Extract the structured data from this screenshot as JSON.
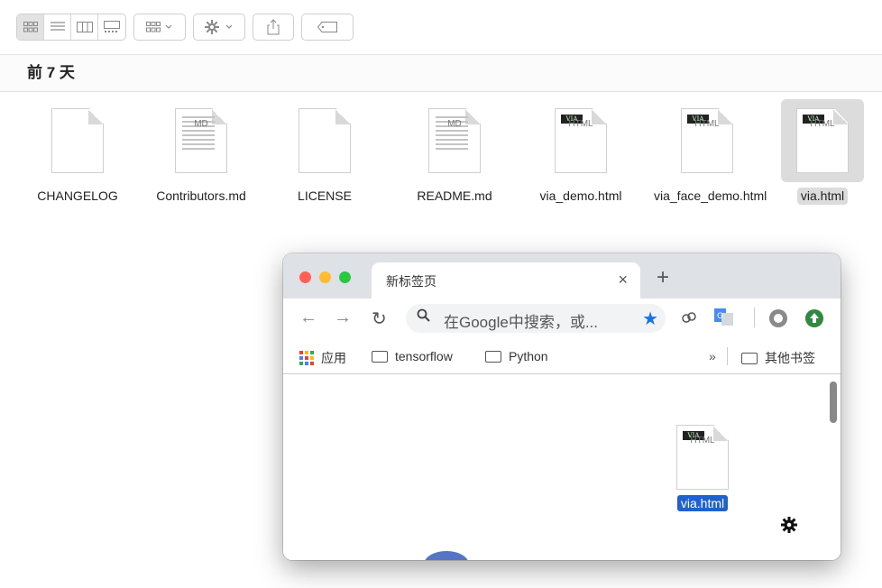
{
  "finder": {
    "section_title": "前 7 天",
    "toolbar": {
      "view_icons": [
        "icon-view-icon",
        "list-view-icon",
        "column-view-icon",
        "gallery-view-icon"
      ],
      "group_icon": "group-by-icon",
      "action_icon": "gear-icon",
      "share_icon": "share-icon",
      "tag_icon": "tag-icon"
    },
    "files": [
      {
        "name": "CHANGELOG",
        "ext": "",
        "kind": "plain"
      },
      {
        "name": "Contributors.md",
        "ext": "MD",
        "kind": "text"
      },
      {
        "name": "LICENSE",
        "ext": "",
        "kind": "plain"
      },
      {
        "name": "README.md",
        "ext": "MD",
        "kind": "text"
      },
      {
        "name": "via_demo.html",
        "ext": "HTML",
        "kind": "via"
      },
      {
        "name": "via_face_demo.html",
        "ext": "HTML",
        "kind": "via"
      },
      {
        "name": "via.html",
        "ext": "HTML",
        "kind": "via",
        "selected": true
      }
    ]
  },
  "chrome": {
    "tab_title": "新标签页",
    "tab_close": "×",
    "new_tab": "+",
    "omnibox_placeholder": "在Google中搜索，或...",
    "bookmarks": {
      "apps_label": "应用",
      "items": [
        "tensorflow",
        "Python"
      ],
      "overflow": "»",
      "other": "其他书签"
    },
    "drag_file": {
      "name": "via.html",
      "ext": "HTML",
      "badge": "VIA"
    }
  },
  "colors": {
    "accent": "#1a73e8",
    "selection": "#1e62d0",
    "traffic_red": "#fe5f57",
    "traffic_yellow": "#febc2e",
    "traffic_green": "#28c840"
  }
}
